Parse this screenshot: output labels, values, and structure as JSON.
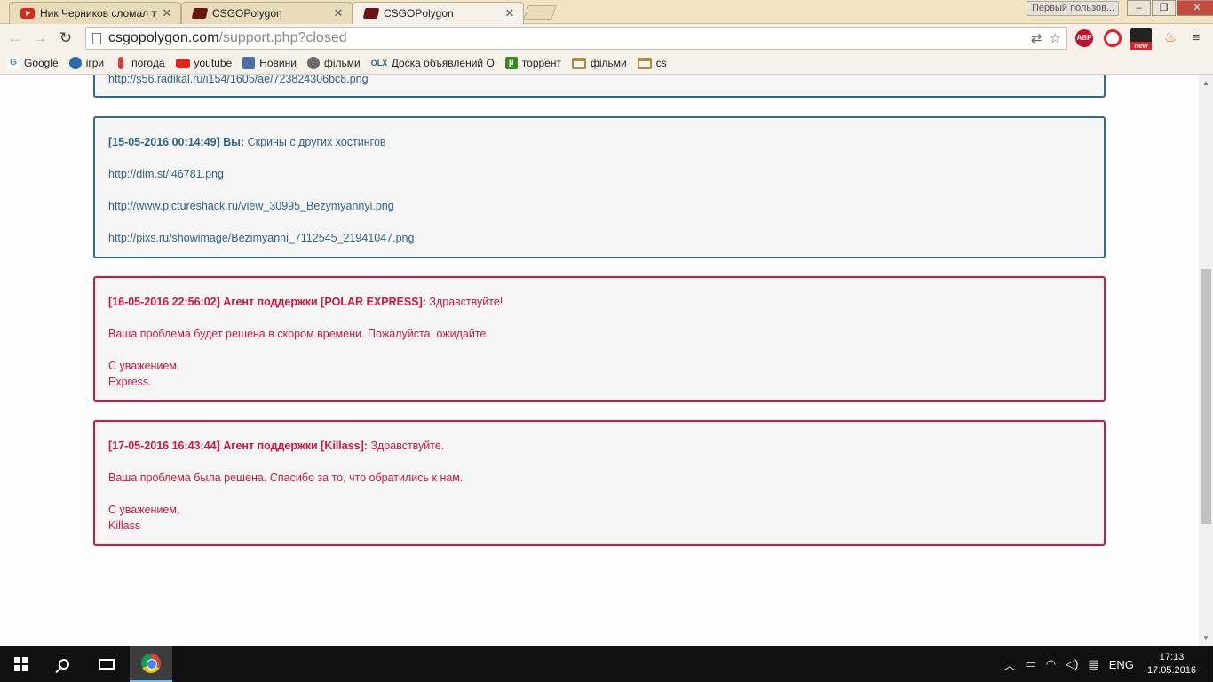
{
  "tabs": [
    {
      "title": "Ник Черников сломал ту",
      "favicon": "youtube-icon"
    },
    {
      "title": "CSGOPolygon",
      "favicon": "csgopolygon-icon"
    },
    {
      "title": "CSGOPolygon",
      "favicon": "csgopolygon-icon"
    }
  ],
  "profile_label": "Первый пользов...",
  "window_buttons": {
    "minimize": "–",
    "maximize": "❐",
    "close": "✕"
  },
  "address": {
    "host": "csgopolygon.com",
    "path": "/support.php?closed"
  },
  "bookmarks": [
    {
      "label": "Google",
      "icon": "google-icon"
    },
    {
      "label": "ігри",
      "icon": "globe-icon"
    },
    {
      "label": "погода",
      "icon": "thermometer-icon"
    },
    {
      "label": "youtube",
      "icon": "youtube-icon"
    },
    {
      "label": "Новини",
      "icon": "news-icon"
    },
    {
      "label": "фільми",
      "icon": "film-icon"
    },
    {
      "label": "Доска объявлений О",
      "icon": "olx-icon"
    },
    {
      "label": "торрент",
      "icon": "torrent-icon"
    },
    {
      "label": "фільми",
      "icon": "folder-icon"
    },
    {
      "label": "cs",
      "icon": "folder-icon"
    }
  ],
  "messages": [
    {
      "type": "user",
      "lines": [
        "http://s56.radikal.ru/i154/1605/ae/723824306bc8.png"
      ]
    },
    {
      "type": "user",
      "header": "[15-05-2016 00:14:49] Вы:",
      "first_text": " Скрины с других хостингов",
      "lines": [
        "http://dim.st/i46781.png",
        "http://www.pictureshack.ru/view_30995_Bezymyannyi.png",
        "http://pixs.ru/showimage/Bezimyanni_7112545_21941047.png"
      ]
    },
    {
      "type": "agent",
      "header": "[16-05-2016 22:56:02] Агент поддержки [POLAR EXPRESS]:",
      "first_text": " Здравствуйте!",
      "body": "Ваша проблема будет решена в скором времени. Пожалуйста, ожидайте.",
      "sign1": "С уважением,",
      "sign2": "Express."
    },
    {
      "type": "agent",
      "header": "[17-05-2016 16:43:44] Агент поддержки [Killass]:",
      "first_text": " Здравствуйте.",
      "body": "Ваша проблема была решена. Спасибо за то, что обратились к нам.",
      "sign1": "С уважением,",
      "sign2": "Killass"
    }
  ],
  "taskbar": {
    "language": "ENG",
    "time": "17:13",
    "date": "17.05.2016"
  },
  "colors": {
    "user_border": "#2e6b8f",
    "agent_border": "#d3163a"
  }
}
